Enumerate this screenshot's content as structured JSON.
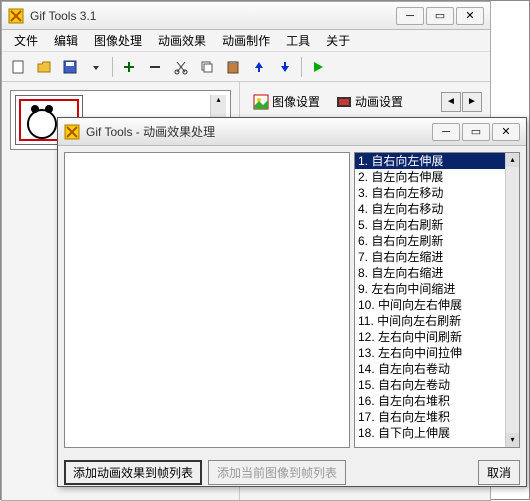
{
  "main_window": {
    "title": "Gif Tools 3.1",
    "menu": [
      "文件",
      "编辑",
      "图像处理",
      "动画效果",
      "动画制作",
      "工具",
      "关于"
    ]
  },
  "right_panel": {
    "image_settings": "图像设置",
    "anim_settings": "动画设置"
  },
  "dialog": {
    "title": "Gif Tools - 动画效果处理",
    "effects": [
      "1. 自右向左伸展",
      "2. 自左向右伸展",
      "3. 自右向左移动",
      "4. 自左向右移动",
      "5. 自左向右刷新",
      "6. 自右向左刷新",
      "7. 自右向左缩进",
      "8. 自左向右缩进",
      "9. 左右向中间缩进",
      "10. 中间向左右伸展",
      "11. 中间向左右刷新",
      "12. 左右向中间刷新",
      "13. 左右向中间拉伸",
      "14. 自左向右卷动",
      "15. 自右向左卷动",
      "16. 自左向右堆积",
      "17. 自右向左堆积",
      "18. 自下向上伸展"
    ],
    "btn_add_effect": "添加动画效果到帧列表",
    "btn_add_current": "添加当前图像到帧列表",
    "btn_cancel": "取消"
  }
}
